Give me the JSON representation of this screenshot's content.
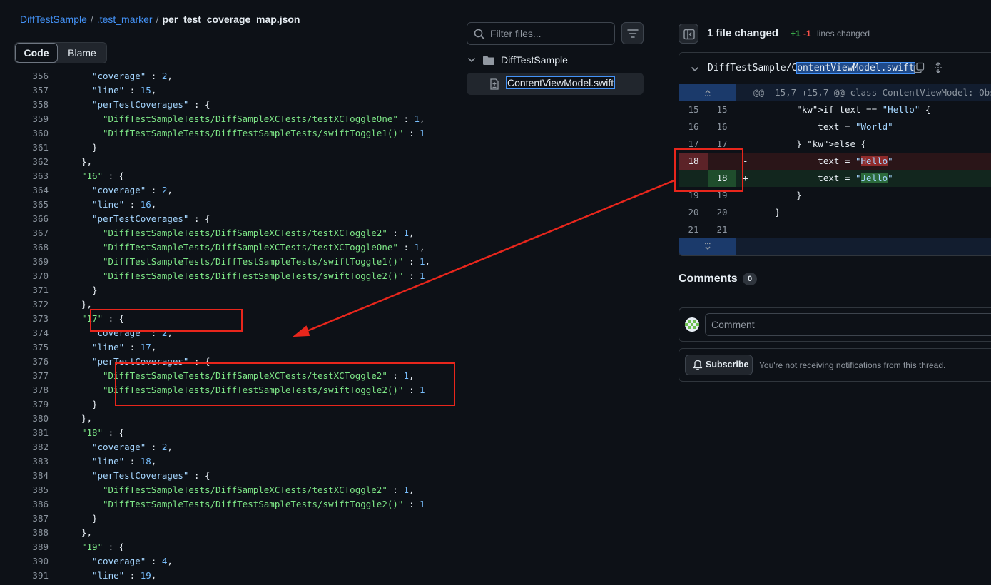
{
  "breadcrumb": {
    "repo": "DiffTestSample",
    "dir": ".test_marker",
    "file": "per_test_coverage_map.json",
    "sep": "/"
  },
  "view_tabs": {
    "code": "Code",
    "blame": "Blame"
  },
  "code_lines": [
    {
      "n": "356",
      "indent": 6,
      "parts": [
        [
          "s",
          "\"coverage\""
        ],
        [
          "p",
          " : "
        ],
        [
          "n",
          "2"
        ],
        [
          "p",
          ","
        ]
      ]
    },
    {
      "n": "357",
      "indent": 6,
      "parts": [
        [
          "s",
          "\"line\""
        ],
        [
          "p",
          " : "
        ],
        [
          "n",
          "15"
        ],
        [
          "p",
          ","
        ]
      ]
    },
    {
      "n": "358",
      "indent": 6,
      "parts": [
        [
          "s",
          "\"perTestCoverages\""
        ],
        [
          "p",
          " : {"
        ]
      ]
    },
    {
      "n": "359",
      "indent": 8,
      "parts": [
        [
          "k",
          "\"DiffTestSampleTests/DiffSampleXCTests/testXCToggleOne\""
        ],
        [
          "p",
          " : "
        ],
        [
          "n",
          "1"
        ],
        [
          "p",
          ","
        ]
      ]
    },
    {
      "n": "360",
      "indent": 8,
      "parts": [
        [
          "k",
          "\"DiffTestSampleTests/DiffTestSampleTests/swiftToggle1()\""
        ],
        [
          "p",
          " : "
        ],
        [
          "n",
          "1"
        ]
      ]
    },
    {
      "n": "361",
      "indent": 6,
      "parts": [
        [
          "p",
          "}"
        ]
      ]
    },
    {
      "n": "362",
      "indent": 4,
      "parts": [
        [
          "p",
          "},"
        ]
      ]
    },
    {
      "n": "363",
      "indent": 4,
      "parts": [
        [
          "k",
          "\"16\""
        ],
        [
          "p",
          " : {"
        ]
      ]
    },
    {
      "n": "364",
      "indent": 6,
      "parts": [
        [
          "s",
          "\"coverage\""
        ],
        [
          "p",
          " : "
        ],
        [
          "n",
          "2"
        ],
        [
          "p",
          ","
        ]
      ]
    },
    {
      "n": "365",
      "indent": 6,
      "parts": [
        [
          "s",
          "\"line\""
        ],
        [
          "p",
          " : "
        ],
        [
          "n",
          "16"
        ],
        [
          "p",
          ","
        ]
      ]
    },
    {
      "n": "366",
      "indent": 6,
      "parts": [
        [
          "s",
          "\"perTestCoverages\""
        ],
        [
          "p",
          " : {"
        ]
      ]
    },
    {
      "n": "367",
      "indent": 8,
      "parts": [
        [
          "k",
          "\"DiffTestSampleTests/DiffSampleXCTests/testXCToggle2\""
        ],
        [
          "p",
          " : "
        ],
        [
          "n",
          "1"
        ],
        [
          "p",
          ","
        ]
      ]
    },
    {
      "n": "368",
      "indent": 8,
      "parts": [
        [
          "k",
          "\"DiffTestSampleTests/DiffSampleXCTests/testXCToggleOne\""
        ],
        [
          "p",
          " : "
        ],
        [
          "n",
          "1"
        ],
        [
          "p",
          ","
        ]
      ]
    },
    {
      "n": "369",
      "indent": 8,
      "parts": [
        [
          "k",
          "\"DiffTestSampleTests/DiffTestSampleTests/swiftToggle1()\""
        ],
        [
          "p",
          " : "
        ],
        [
          "n",
          "1"
        ],
        [
          "p",
          ","
        ]
      ]
    },
    {
      "n": "370",
      "indent": 8,
      "parts": [
        [
          "k",
          "\"DiffTestSampleTests/DiffTestSampleTests/swiftToggle2()\""
        ],
        [
          "p",
          " : "
        ],
        [
          "n",
          "1"
        ]
      ]
    },
    {
      "n": "371",
      "indent": 6,
      "parts": [
        [
          "p",
          "}"
        ]
      ]
    },
    {
      "n": "372",
      "indent": 4,
      "parts": [
        [
          "p",
          "},"
        ]
      ]
    },
    {
      "n": "373",
      "indent": 4,
      "parts": [
        [
          "k",
          "\"17\""
        ],
        [
          "p",
          " : {"
        ]
      ]
    },
    {
      "n": "374",
      "indent": 6,
      "parts": [
        [
          "s",
          "\"coverage\""
        ],
        [
          "p",
          " : "
        ],
        [
          "n",
          "2"
        ],
        [
          "p",
          ","
        ]
      ]
    },
    {
      "n": "375",
      "indent": 6,
      "parts": [
        [
          "s",
          "\"line\""
        ],
        [
          "p",
          " : "
        ],
        [
          "n",
          "17"
        ],
        [
          "p",
          ","
        ]
      ]
    },
    {
      "n": "376",
      "indent": 6,
      "parts": [
        [
          "s",
          "\"perTestCoverages\""
        ],
        [
          "p",
          " : {"
        ]
      ]
    },
    {
      "n": "377",
      "indent": 8,
      "parts": [
        [
          "k",
          "\"DiffTestSampleTests/DiffSampleXCTests/testXCToggle2\""
        ],
        [
          "p",
          " : "
        ],
        [
          "n",
          "1"
        ],
        [
          "p",
          ","
        ]
      ]
    },
    {
      "n": "378",
      "indent": 8,
      "parts": [
        [
          "k",
          "\"DiffTestSampleTests/DiffTestSampleTests/swiftToggle2()\""
        ],
        [
          "p",
          " : "
        ],
        [
          "n",
          "1"
        ]
      ]
    },
    {
      "n": "379",
      "indent": 6,
      "parts": [
        [
          "p",
          "}"
        ]
      ]
    },
    {
      "n": "380",
      "indent": 4,
      "parts": [
        [
          "p",
          "},"
        ]
      ]
    },
    {
      "n": "381",
      "indent": 4,
      "parts": [
        [
          "k",
          "\"18\""
        ],
        [
          "p",
          " : {"
        ]
      ]
    },
    {
      "n": "382",
      "indent": 6,
      "parts": [
        [
          "s",
          "\"coverage\""
        ],
        [
          "p",
          " : "
        ],
        [
          "n",
          "2"
        ],
        [
          "p",
          ","
        ]
      ]
    },
    {
      "n": "383",
      "indent": 6,
      "parts": [
        [
          "s",
          "\"line\""
        ],
        [
          "p",
          " : "
        ],
        [
          "n",
          "18"
        ],
        [
          "p",
          ","
        ]
      ]
    },
    {
      "n": "384",
      "indent": 6,
      "parts": [
        [
          "s",
          "\"perTestCoverages\""
        ],
        [
          "p",
          " : {"
        ]
      ]
    },
    {
      "n": "385",
      "indent": 8,
      "parts": [
        [
          "k",
          "\"DiffTestSampleTests/DiffSampleXCTests/testXCToggle2\""
        ],
        [
          "p",
          " : "
        ],
        [
          "n",
          "1"
        ],
        [
          "p",
          ","
        ]
      ]
    },
    {
      "n": "386",
      "indent": 8,
      "parts": [
        [
          "k",
          "\"DiffTestSampleTests/DiffTestSampleTests/swiftToggle2()\""
        ],
        [
          "p",
          " : "
        ],
        [
          "n",
          "1"
        ]
      ]
    },
    {
      "n": "387",
      "indent": 6,
      "parts": [
        [
          "p",
          "}"
        ]
      ]
    },
    {
      "n": "388",
      "indent": 4,
      "parts": [
        [
          "p",
          "},"
        ]
      ]
    },
    {
      "n": "389",
      "indent": 4,
      "parts": [
        [
          "k",
          "\"19\""
        ],
        [
          "p",
          " : {"
        ]
      ]
    },
    {
      "n": "390",
      "indent": 6,
      "parts": [
        [
          "s",
          "\"coverage\""
        ],
        [
          "p",
          " : "
        ],
        [
          "n",
          "4"
        ],
        [
          "p",
          ","
        ]
      ]
    },
    {
      "n": "391",
      "indent": 6,
      "parts": [
        [
          "s",
          "\"line\""
        ],
        [
          "p",
          " : "
        ],
        [
          "n",
          "19"
        ],
        [
          "p",
          ","
        ]
      ]
    }
  ],
  "file_tree": {
    "filter_placeholder": "Filter files...",
    "folder": "DiffTestSample",
    "file": "ContentViewModel.swift"
  },
  "diff_summary": {
    "files_changed": "1 file changed",
    "additions": "+1",
    "deletions": "-1",
    "lines_changed": "lines changed"
  },
  "diff_file": {
    "path_prefix": "DiffTestSample/C",
    "path_selected": "ontentViewModel.swift"
  },
  "diff_rows": [
    {
      "type": "hunk",
      "a": "",
      "b": "",
      "sign": "",
      "code": "@@ -15,7 +15,7 @@ class ContentViewModel: Obs"
    },
    {
      "type": "ctx",
      "a": "15",
      "b": "15",
      "sign": "",
      "code": "        if text == \"Hello\" {"
    },
    {
      "type": "ctx",
      "a": "16",
      "b": "16",
      "sign": "",
      "code": "            text = \"World\""
    },
    {
      "type": "ctx",
      "a": "17",
      "b": "17",
      "sign": "",
      "code": "        } else {"
    },
    {
      "type": "del",
      "a": "18",
      "b": "",
      "sign": "-",
      "code": "            text = \"Hello\""
    },
    {
      "type": "add",
      "a": "",
      "b": "18",
      "sign": "+",
      "code": "            text = \"Jello\""
    },
    {
      "type": "ctx",
      "a": "19",
      "b": "19",
      "sign": "",
      "code": "        }"
    },
    {
      "type": "ctx",
      "a": "20",
      "b": "20",
      "sign": "",
      "code": "    }"
    },
    {
      "type": "ctx",
      "a": "21",
      "b": "21",
      "sign": "",
      "code": ""
    },
    {
      "type": "hunk-end",
      "a": "",
      "b": "",
      "sign": "",
      "code": ""
    }
  ],
  "comments": {
    "title": "Comments",
    "count": "0",
    "placeholder": "Comment"
  },
  "subscribe": {
    "button": "Subscribe",
    "note": "You're not receiving notifications from this thread."
  },
  "colors": {
    "annotation": "#e8261c",
    "link": "#4493f8",
    "add": "#3fb950",
    "del": "#f85149"
  }
}
